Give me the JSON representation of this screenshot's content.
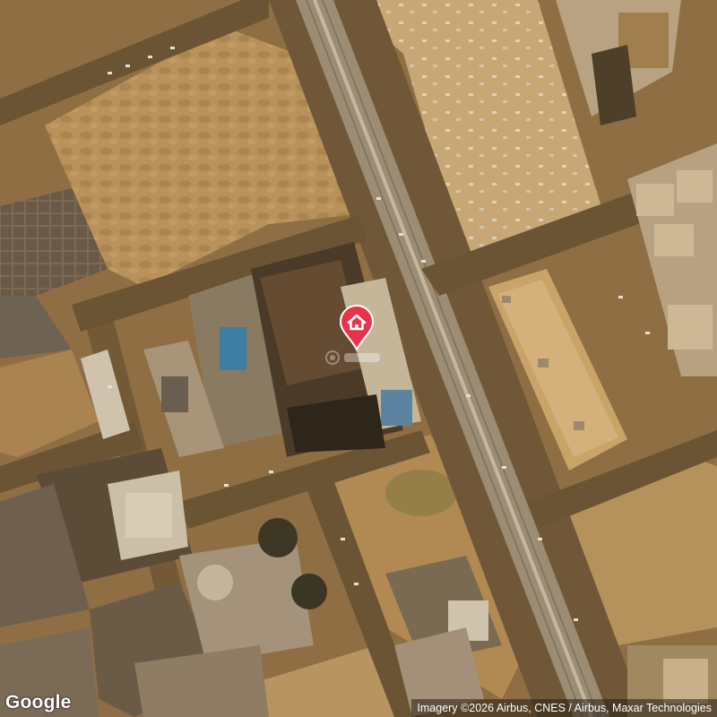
{
  "map": {
    "type": "satellite",
    "logo_text": "Google",
    "attribution": "Imagery ©2026 Airbus, CNES / Airbus, Maxar Technologies",
    "marker": {
      "icon": "home-icon",
      "color": "#e8334a"
    },
    "watermark_icon": "camera-icon"
  }
}
